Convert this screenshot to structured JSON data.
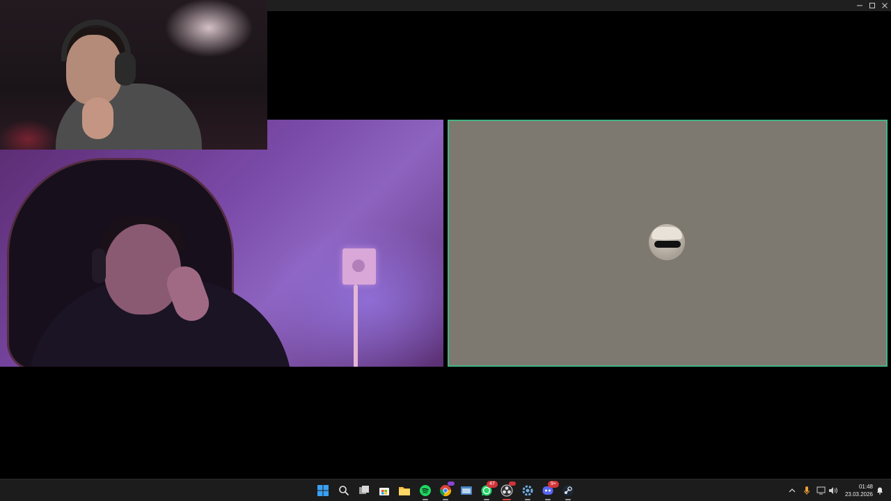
{
  "window": {
    "controls": [
      "minimize-icon",
      "maximize-icon",
      "close-icon"
    ]
  },
  "tiles": {
    "left_camera": {
      "type": "video",
      "speaking": false
    },
    "pip_camera": {
      "type": "video"
    },
    "right_tile": {
      "type": "avatar",
      "speaking": true,
      "background_color": "#7d7870",
      "speaking_border_color": "#43b581"
    }
  },
  "taskbar": {
    "apps": [
      {
        "icon": "windows-start-icon"
      },
      {
        "icon": "search-icon"
      },
      {
        "icon": "task-view-icon"
      },
      {
        "icon": "microsoft-store-icon"
      },
      {
        "icon": "file-explorer-icon"
      },
      {
        "icon": "spotify-icon"
      },
      {
        "icon": "chrome-icon",
        "badge": ""
      },
      {
        "icon": "app-window-icon"
      },
      {
        "icon": "whatsapp-icon",
        "badge": "47"
      },
      {
        "icon": "obs-icon"
      },
      {
        "icon": "gear-app-icon"
      },
      {
        "icon": "discord-icon",
        "badge": "9+"
      },
      {
        "icon": "steam-icon"
      }
    ],
    "tray": [
      "chevron-up-icon",
      "microphone-icon",
      "network-icon",
      "volume-icon"
    ],
    "clock": {
      "time": "01:48",
      "date": "23.03.2026"
    },
    "notification_icon": "notification-bell-icon"
  },
  "colors": {
    "accent_green": "#43b581",
    "badge_red": "#d13438",
    "taskbar": "#1c1c1c"
  }
}
